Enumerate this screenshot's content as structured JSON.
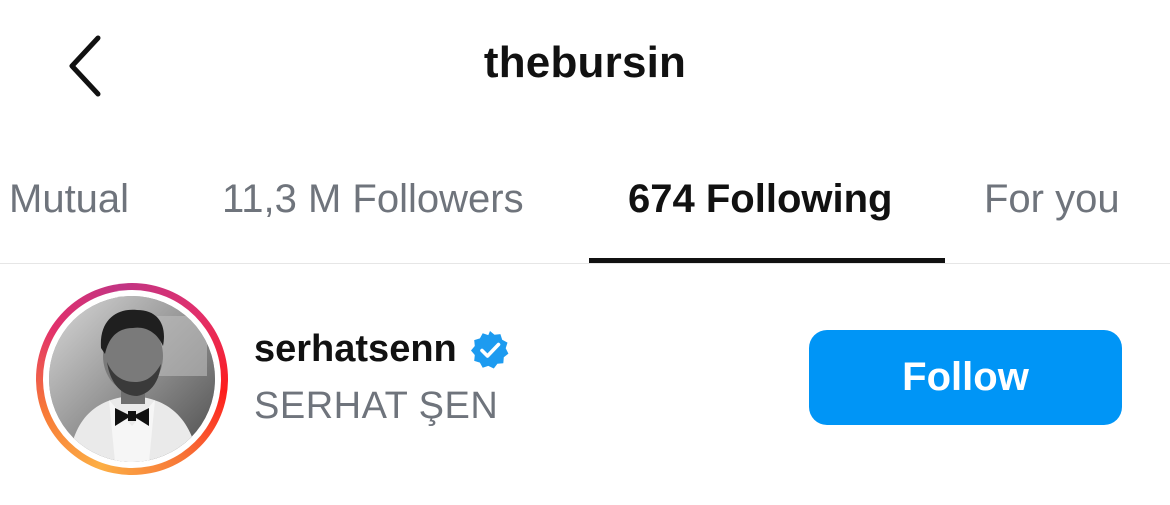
{
  "header": {
    "title": "thebursin",
    "back_icon": "chevron-left-icon"
  },
  "tabs": [
    {
      "label": "Mutual",
      "active": false
    },
    {
      "label": "11,3 M Followers",
      "active": false
    },
    {
      "label": "674 Following",
      "active": true
    },
    {
      "label": "For you",
      "active": false
    }
  ],
  "user": {
    "username": "serhatsenn",
    "verified": true,
    "verified_icon": "verified-badge-icon",
    "full_name": "SERHAT ŞEN",
    "has_story": true
  },
  "follow_button": {
    "label": "Follow"
  },
  "colors": {
    "accent": "#0095f6",
    "text_primary": "#111111",
    "text_secondary": "#6f747c",
    "verified": "#1d9bf0"
  }
}
